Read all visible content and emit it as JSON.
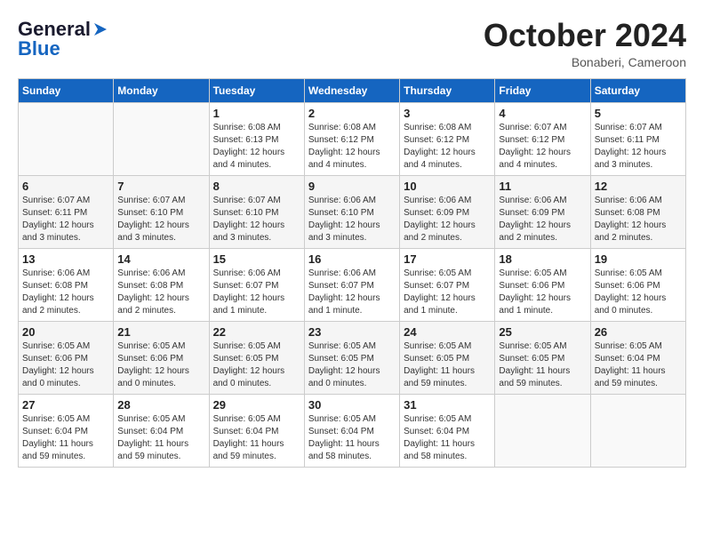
{
  "logo": {
    "part1": "General",
    "part2": "Blue"
  },
  "title": {
    "month_year": "October 2024",
    "location": "Bonaberi, Cameroon"
  },
  "days_of_week": [
    "Sunday",
    "Monday",
    "Tuesday",
    "Wednesday",
    "Thursday",
    "Friday",
    "Saturday"
  ],
  "weeks": [
    [
      {
        "day": "",
        "info": ""
      },
      {
        "day": "",
        "info": ""
      },
      {
        "day": "1",
        "info": "Sunrise: 6:08 AM\nSunset: 6:13 PM\nDaylight: 12 hours\nand 4 minutes."
      },
      {
        "day": "2",
        "info": "Sunrise: 6:08 AM\nSunset: 6:12 PM\nDaylight: 12 hours\nand 4 minutes."
      },
      {
        "day": "3",
        "info": "Sunrise: 6:08 AM\nSunset: 6:12 PM\nDaylight: 12 hours\nand 4 minutes."
      },
      {
        "day": "4",
        "info": "Sunrise: 6:07 AM\nSunset: 6:12 PM\nDaylight: 12 hours\nand 4 minutes."
      },
      {
        "day": "5",
        "info": "Sunrise: 6:07 AM\nSunset: 6:11 PM\nDaylight: 12 hours\nand 3 minutes."
      }
    ],
    [
      {
        "day": "6",
        "info": "Sunrise: 6:07 AM\nSunset: 6:11 PM\nDaylight: 12 hours\nand 3 minutes."
      },
      {
        "day": "7",
        "info": "Sunrise: 6:07 AM\nSunset: 6:10 PM\nDaylight: 12 hours\nand 3 minutes."
      },
      {
        "day": "8",
        "info": "Sunrise: 6:07 AM\nSunset: 6:10 PM\nDaylight: 12 hours\nand 3 minutes."
      },
      {
        "day": "9",
        "info": "Sunrise: 6:06 AM\nSunset: 6:10 PM\nDaylight: 12 hours\nand 3 minutes."
      },
      {
        "day": "10",
        "info": "Sunrise: 6:06 AM\nSunset: 6:09 PM\nDaylight: 12 hours\nand 2 minutes."
      },
      {
        "day": "11",
        "info": "Sunrise: 6:06 AM\nSunset: 6:09 PM\nDaylight: 12 hours\nand 2 minutes."
      },
      {
        "day": "12",
        "info": "Sunrise: 6:06 AM\nSunset: 6:08 PM\nDaylight: 12 hours\nand 2 minutes."
      }
    ],
    [
      {
        "day": "13",
        "info": "Sunrise: 6:06 AM\nSunset: 6:08 PM\nDaylight: 12 hours\nand 2 minutes."
      },
      {
        "day": "14",
        "info": "Sunrise: 6:06 AM\nSunset: 6:08 PM\nDaylight: 12 hours\nand 2 minutes."
      },
      {
        "day": "15",
        "info": "Sunrise: 6:06 AM\nSunset: 6:07 PM\nDaylight: 12 hours\nand 1 minute."
      },
      {
        "day": "16",
        "info": "Sunrise: 6:06 AM\nSunset: 6:07 PM\nDaylight: 12 hours\nand 1 minute."
      },
      {
        "day": "17",
        "info": "Sunrise: 6:05 AM\nSunset: 6:07 PM\nDaylight: 12 hours\nand 1 minute."
      },
      {
        "day": "18",
        "info": "Sunrise: 6:05 AM\nSunset: 6:06 PM\nDaylight: 12 hours\nand 1 minute."
      },
      {
        "day": "19",
        "info": "Sunrise: 6:05 AM\nSunset: 6:06 PM\nDaylight: 12 hours\nand 0 minutes."
      }
    ],
    [
      {
        "day": "20",
        "info": "Sunrise: 6:05 AM\nSunset: 6:06 PM\nDaylight: 12 hours\nand 0 minutes."
      },
      {
        "day": "21",
        "info": "Sunrise: 6:05 AM\nSunset: 6:06 PM\nDaylight: 12 hours\nand 0 minutes."
      },
      {
        "day": "22",
        "info": "Sunrise: 6:05 AM\nSunset: 6:05 PM\nDaylight: 12 hours\nand 0 minutes."
      },
      {
        "day": "23",
        "info": "Sunrise: 6:05 AM\nSunset: 6:05 PM\nDaylight: 12 hours\nand 0 minutes."
      },
      {
        "day": "24",
        "info": "Sunrise: 6:05 AM\nSunset: 6:05 PM\nDaylight: 11 hours\nand 59 minutes."
      },
      {
        "day": "25",
        "info": "Sunrise: 6:05 AM\nSunset: 6:05 PM\nDaylight: 11 hours\nand 59 minutes."
      },
      {
        "day": "26",
        "info": "Sunrise: 6:05 AM\nSunset: 6:04 PM\nDaylight: 11 hours\nand 59 minutes."
      }
    ],
    [
      {
        "day": "27",
        "info": "Sunrise: 6:05 AM\nSunset: 6:04 PM\nDaylight: 11 hours\nand 59 minutes."
      },
      {
        "day": "28",
        "info": "Sunrise: 6:05 AM\nSunset: 6:04 PM\nDaylight: 11 hours\nand 59 minutes."
      },
      {
        "day": "29",
        "info": "Sunrise: 6:05 AM\nSunset: 6:04 PM\nDaylight: 11 hours\nand 59 minutes."
      },
      {
        "day": "30",
        "info": "Sunrise: 6:05 AM\nSunset: 6:04 PM\nDaylight: 11 hours\nand 58 minutes."
      },
      {
        "day": "31",
        "info": "Sunrise: 6:05 AM\nSunset: 6:04 PM\nDaylight: 11 hours\nand 58 minutes."
      },
      {
        "day": "",
        "info": ""
      },
      {
        "day": "",
        "info": ""
      }
    ]
  ]
}
